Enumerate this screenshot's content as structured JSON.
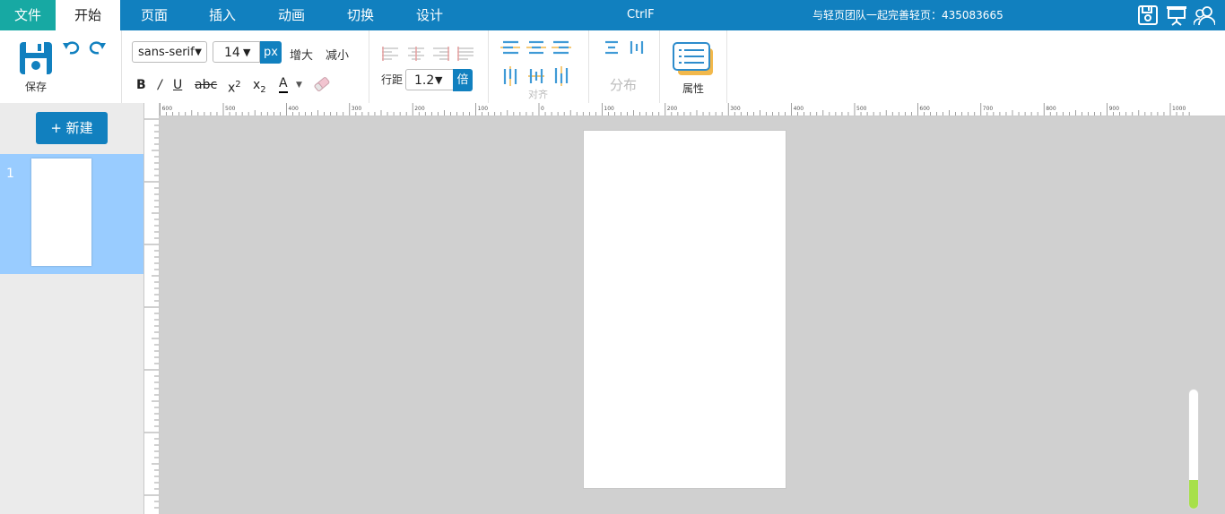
{
  "menu": {
    "file": "文件",
    "start": "开始",
    "page": "页面",
    "insert": "插入",
    "animation": "动画",
    "switch": "切换",
    "design": "设计"
  },
  "header": {
    "title": "CtrlF",
    "team_text": "与轻页团队一起完善轻页：435083665",
    "icons": [
      "save-icon",
      "presentation-icon",
      "users-icon"
    ]
  },
  "toolbar": {
    "save_label": "保存",
    "font_family": "sans-serif",
    "font_size": "14",
    "unit": "px",
    "increase": "增大",
    "decrease": "减小",
    "bold": "B",
    "italic": "/",
    "underline": "U",
    "strike": "abc",
    "superscript_base": "x",
    "superscript_exp": "2",
    "subscript_base": "x",
    "subscript_exp": "2",
    "font_color": "A",
    "line_height_label": "行距",
    "line_height": "1.2",
    "times": "倍",
    "align_label": "对齐",
    "distribute_label": "分布",
    "properties_label": "属性"
  },
  "sidebar": {
    "new_button": "+ 新建",
    "slides": [
      {
        "number": "1"
      }
    ]
  },
  "ruler": {
    "labels": [
      "600",
      "500",
      "400",
      "300",
      "200",
      "100",
      "0",
      "100",
      "200",
      "300",
      "400",
      "500",
      "600",
      "700",
      "800",
      "900",
      "1000"
    ]
  },
  "zoom": {
    "fraction": 0.24
  },
  "colors": {
    "brand": "#1180bf",
    "file_tab": "#17a9a3",
    "selected_slide": "#99ccff",
    "canvas_bg": "#d0d0d0",
    "zoom_fill": "#a7e04a"
  }
}
